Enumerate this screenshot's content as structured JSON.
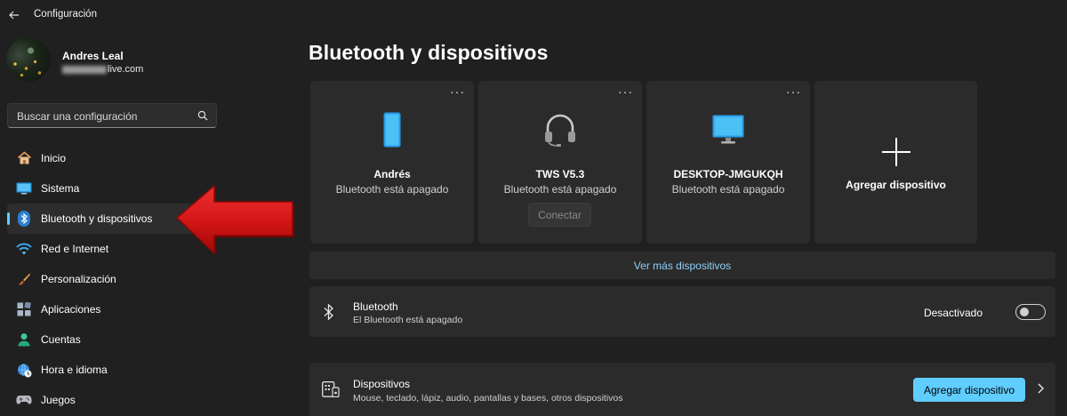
{
  "window": {
    "title": "Configuración",
    "back_icon": "back-arrow-icon"
  },
  "profile": {
    "name": "Andres Leal",
    "email_visible": "live.com"
  },
  "search": {
    "placeholder": "Buscar una configuración",
    "icon": "search-icon"
  },
  "sidebar": {
    "items": [
      {
        "label": "Inicio",
        "icon": "home-icon",
        "active": false
      },
      {
        "label": "Sistema",
        "icon": "monitor-icon",
        "active": false
      },
      {
        "label": "Bluetooth y dispositivos",
        "icon": "bluetooth-icon",
        "active": true
      },
      {
        "label": "Red e Internet",
        "icon": "wifi-icon",
        "active": false
      },
      {
        "label": "Personalización",
        "icon": "brush-icon",
        "active": false
      },
      {
        "label": "Aplicaciones",
        "icon": "apps-icon",
        "active": false
      },
      {
        "label": "Cuentas",
        "icon": "person-icon",
        "active": false
      },
      {
        "label": "Hora e idioma",
        "icon": "globe-clock-icon",
        "active": false
      },
      {
        "label": "Juegos",
        "icon": "gamepad-icon",
        "active": false
      }
    ]
  },
  "main": {
    "title": "Bluetooth y dispositivos",
    "devices": [
      {
        "name": "Andrés",
        "status": "Bluetooth está apagado",
        "icon": "phone-icon",
        "more": "···"
      },
      {
        "name": "TWS V5.3",
        "status": "Bluetooth está apagado",
        "icon": "headset-icon",
        "more": "···",
        "button": "Conectar"
      },
      {
        "name": "DESKTOP-JMGUKQH",
        "status": "Bluetooth está apagado",
        "icon": "desktop-icon",
        "more": "···"
      }
    ],
    "add_device_card": {
      "label": "Agregar dispositivo",
      "icon": "plus-icon"
    },
    "more_devices_link": "Ver más dispositivos",
    "bluetooth_row": {
      "title": "Bluetooth",
      "subtitle": "El Bluetooth está apagado",
      "toggle_label": "Desactivado",
      "toggle_on": false
    },
    "devices_row": {
      "title": "Dispositivos",
      "subtitle": "Mouse, teclado, lápiz, audio, pantallas y bases, otros dispositivos",
      "button": "Agregar dispositivo"
    }
  },
  "colors": {
    "accent": "#60cdff",
    "background": "#202020",
    "card": "#2b2b2b",
    "annotation_arrow": "#d81818"
  }
}
